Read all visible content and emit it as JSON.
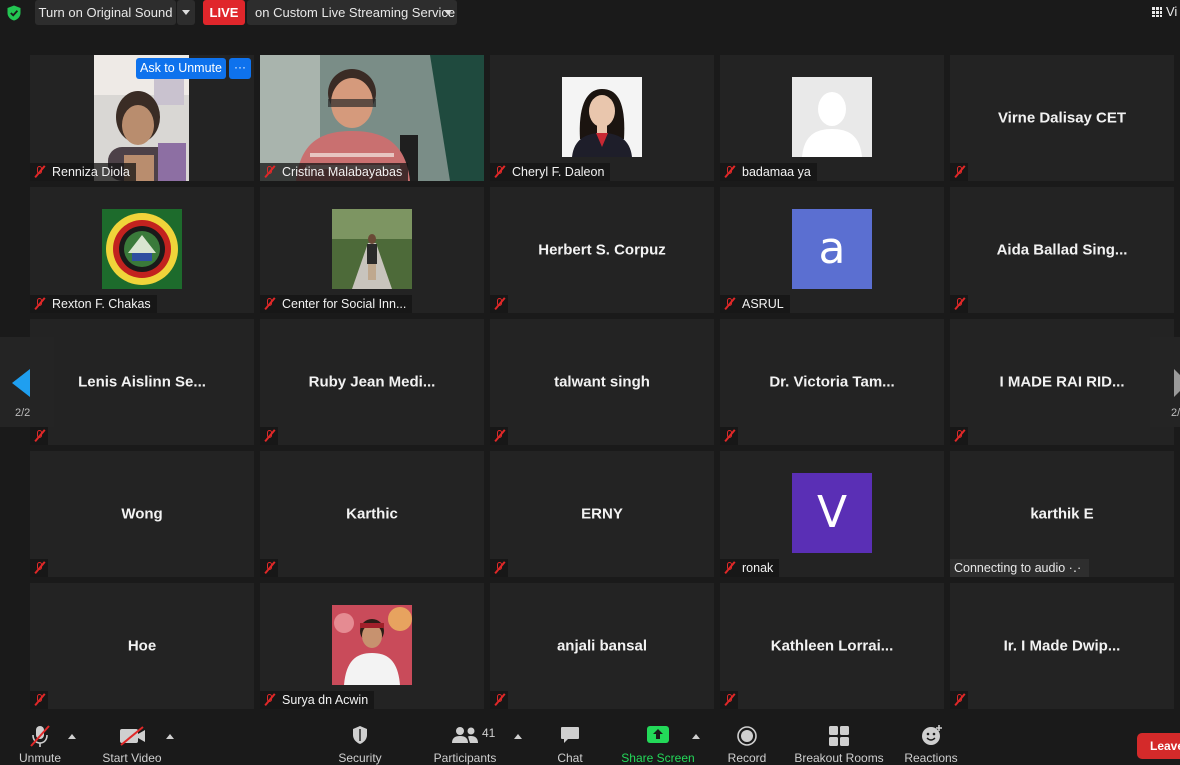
{
  "topbar": {
    "sound_button": "Turn on Original Sound",
    "live_badge": "LIVE",
    "live_text": "on Custom Live Streaming Service",
    "view_label": "Vi"
  },
  "tiles": [
    {
      "name": "Renniza Diola"
    },
    {
      "name": "Cristina Malabayabas"
    },
    {
      "name": "Cheryl F. Daleon"
    },
    {
      "name": "badamaa ya"
    },
    {
      "name": "Virne Dalisay CET"
    },
    {
      "name": "Rexton F. Chakas"
    },
    {
      "name": "Center for Social Inn..."
    },
    {
      "name": "Herbert S. Corpuz"
    },
    {
      "name": "ASRUL",
      "avatar_letter": "a"
    },
    {
      "name": "Aida Ballad Sing..."
    },
    {
      "name": "Lenis Aislinn Se..."
    },
    {
      "name": "Ruby Jean Medi..."
    },
    {
      "name": "talwant singh"
    },
    {
      "name": "Dr. Victoria Tam..."
    },
    {
      "name": "I MADE RAI RID..."
    },
    {
      "name": "Wong"
    },
    {
      "name": "Karthic"
    },
    {
      "name": "ERNY"
    },
    {
      "name": "ronak",
      "avatar_letter": "V"
    },
    {
      "name": "karthik E",
      "status": "Connecting to audio ·․·"
    },
    {
      "name": "Hoe"
    },
    {
      "name": "Surya dn Acwin"
    },
    {
      "name": "anjali bansal"
    },
    {
      "name": "Kathleen  Lorrai..."
    },
    {
      "name": "Ir. I Made Dwip..."
    }
  ],
  "overlay": {
    "ask_unmute": "Ask to Unmute",
    "more": "···"
  },
  "pager": {
    "left": "2/2",
    "right": "2/"
  },
  "toolbar": {
    "unmute": "Unmute",
    "start_video": "Start Video",
    "security": "Security",
    "participants": "Participants",
    "participants_count": "41",
    "chat": "Chat",
    "share_screen": "Share Screen",
    "record": "Record",
    "breakout_rooms": "Breakout Rooms",
    "reactions": "Reactions",
    "leave": "Leave"
  },
  "colors": {
    "accent_blue": "#0e72ed",
    "live_red": "#e0262b",
    "share_green": "#23d959",
    "avatar_a": "#5b6fd1",
    "avatar_v": "#5a2fb5"
  }
}
